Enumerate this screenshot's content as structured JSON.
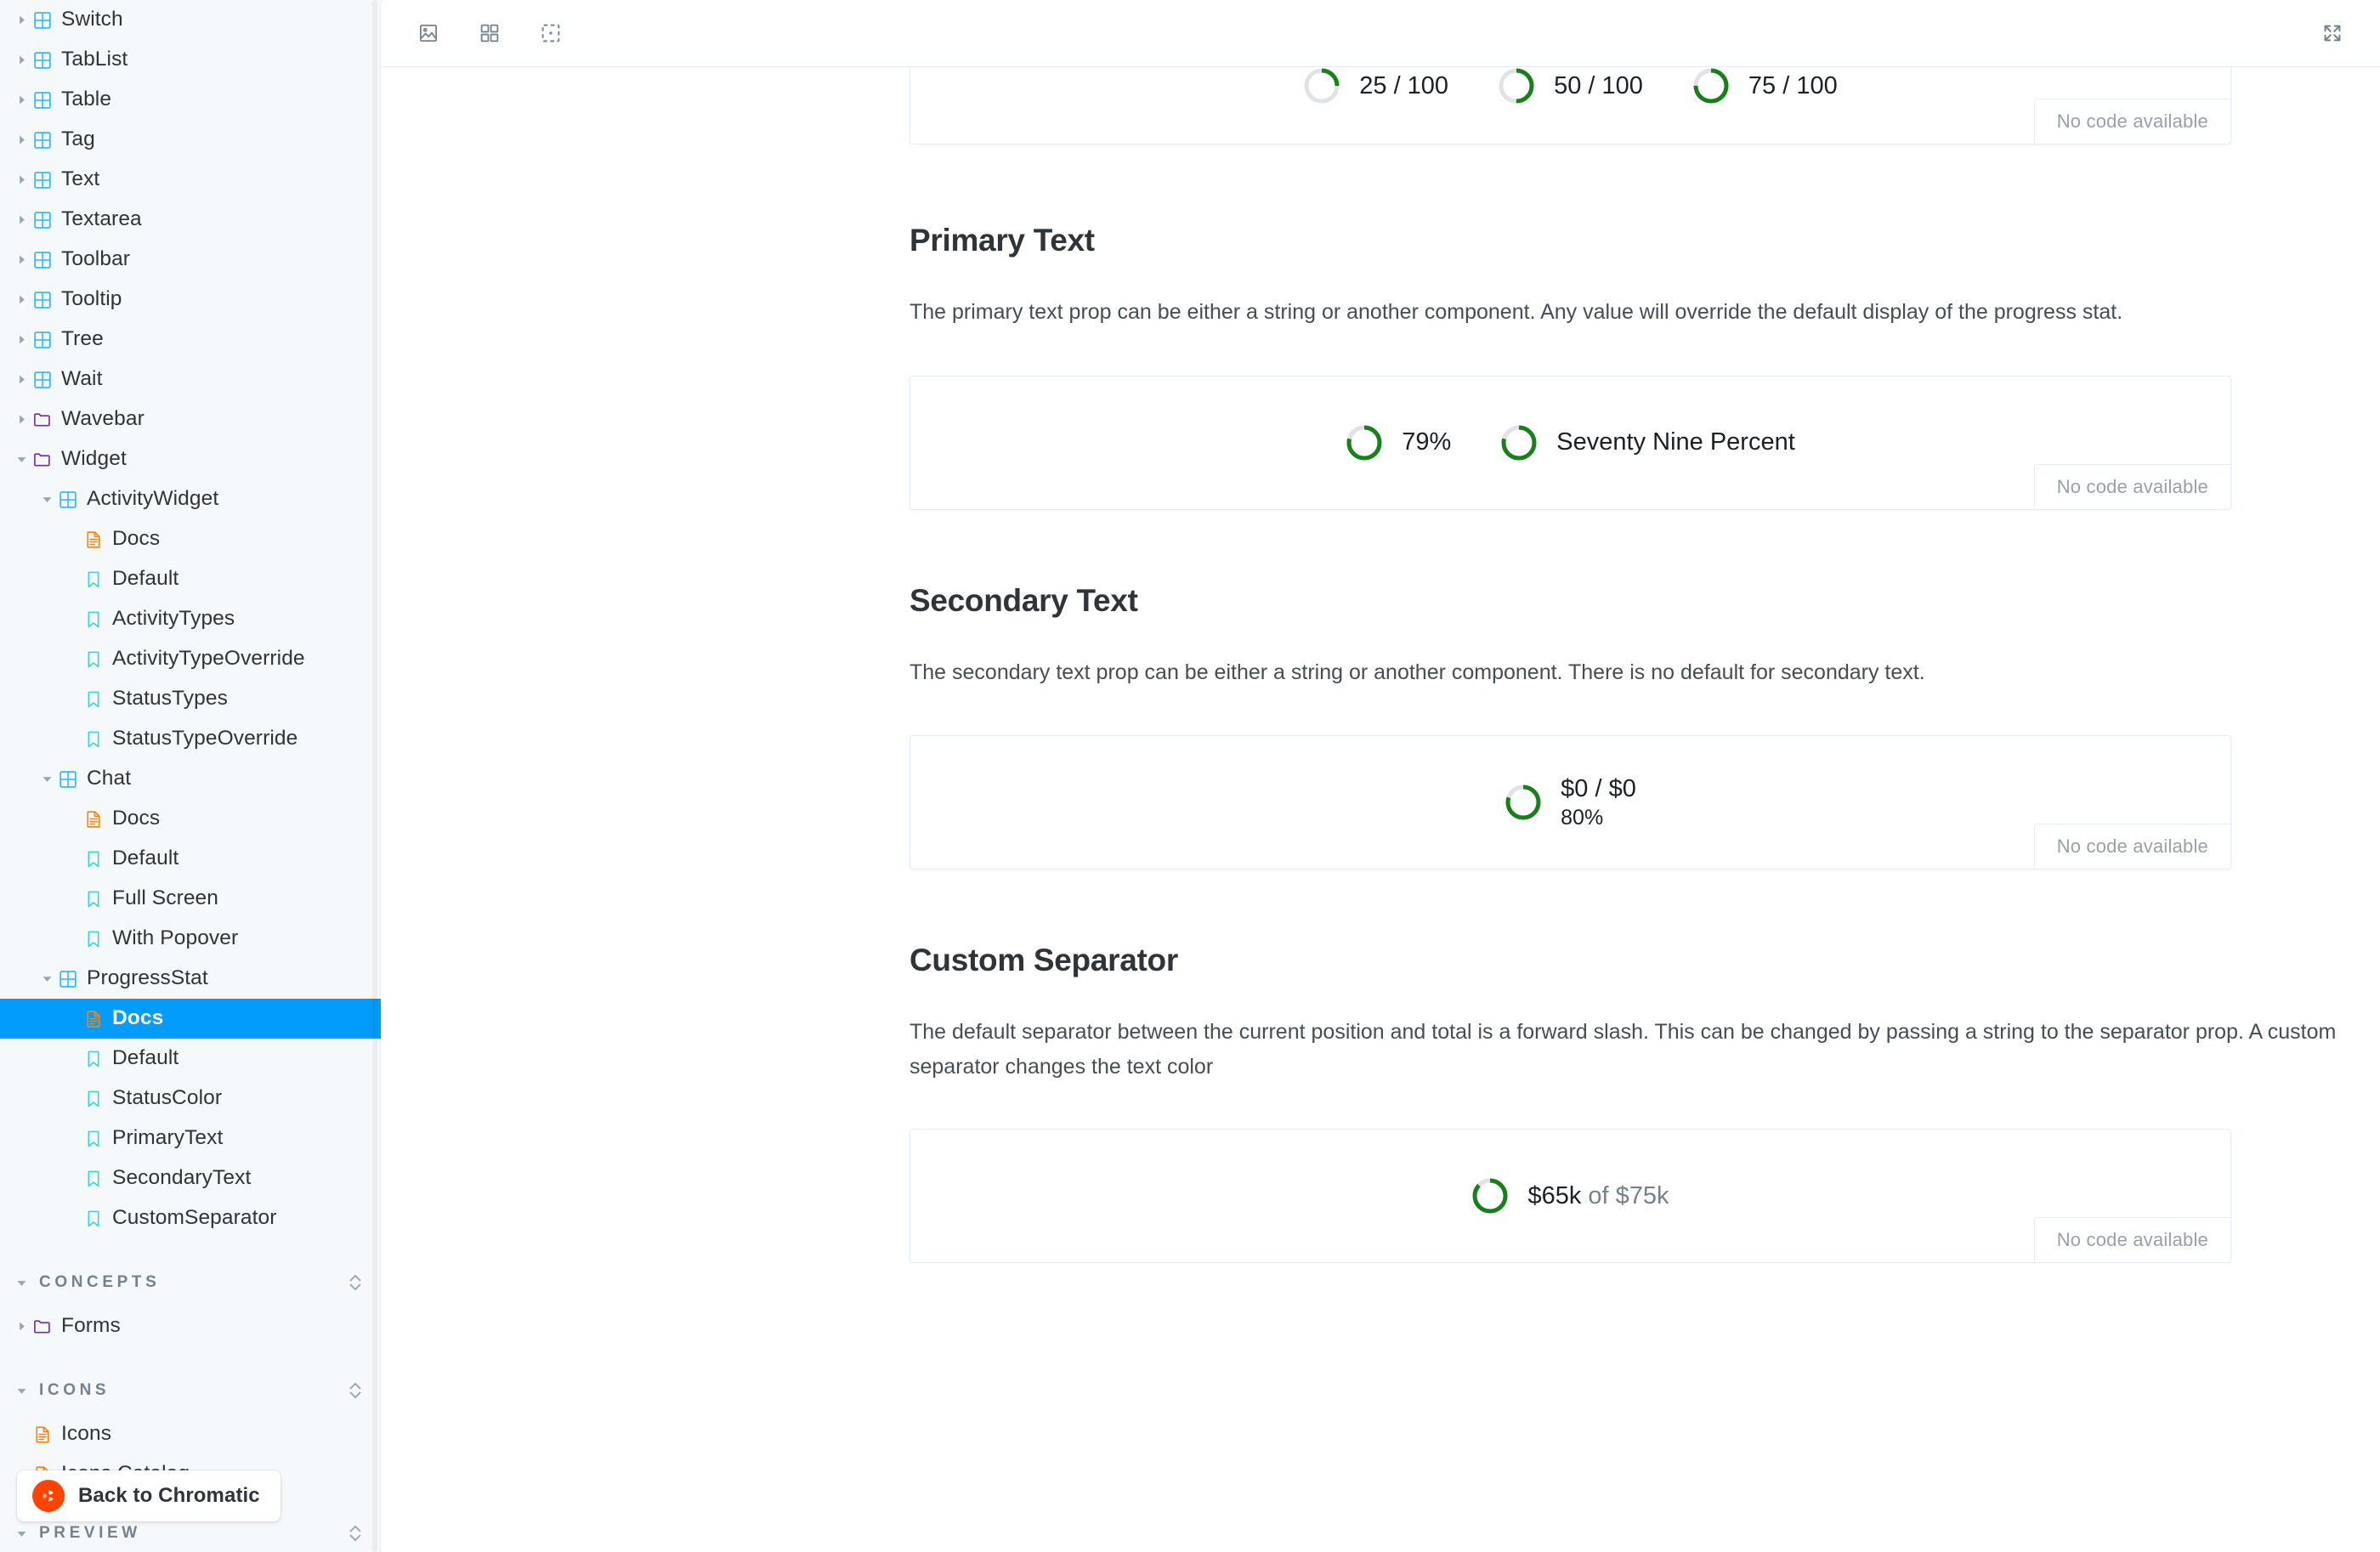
{
  "sidebar": {
    "tree": [
      {
        "label": "Switch",
        "depth": 0,
        "icon": "component-icon",
        "caret": "right",
        "selected": false
      },
      {
        "label": "TabList",
        "depth": 0,
        "icon": "component-icon",
        "caret": "right",
        "selected": false
      },
      {
        "label": "Table",
        "depth": 0,
        "icon": "component-icon",
        "caret": "right",
        "selected": false
      },
      {
        "label": "Tag",
        "depth": 0,
        "icon": "component-icon",
        "caret": "right",
        "selected": false
      },
      {
        "label": "Text",
        "depth": 0,
        "icon": "component-icon",
        "caret": "right",
        "selected": false
      },
      {
        "label": "Textarea",
        "depth": 0,
        "icon": "component-icon",
        "caret": "right",
        "selected": false
      },
      {
        "label": "Toolbar",
        "depth": 0,
        "icon": "component-icon",
        "caret": "right",
        "selected": false
      },
      {
        "label": "Tooltip",
        "depth": 0,
        "icon": "component-icon",
        "caret": "right",
        "selected": false
      },
      {
        "label": "Tree",
        "depth": 0,
        "icon": "component-icon",
        "caret": "right",
        "selected": false
      },
      {
        "label": "Wait",
        "depth": 0,
        "icon": "component-icon",
        "caret": "right",
        "selected": false
      },
      {
        "label": "Wavebar",
        "depth": 0,
        "icon": "folder-icon",
        "caret": "right",
        "selected": false
      },
      {
        "label": "Widget",
        "depth": 0,
        "icon": "folder-icon",
        "caret": "down",
        "selected": false
      },
      {
        "label": "ActivityWidget",
        "depth": 1,
        "icon": "component-icon",
        "caret": "down",
        "selected": false
      },
      {
        "label": "Docs",
        "depth": 2,
        "icon": "docs-icon",
        "caret": "none",
        "selected": false
      },
      {
        "label": "Default",
        "depth": 2,
        "icon": "story-icon",
        "caret": "none",
        "selected": false
      },
      {
        "label": "ActivityTypes",
        "depth": 2,
        "icon": "story-icon",
        "caret": "none",
        "selected": false
      },
      {
        "label": "ActivityTypeOverride",
        "depth": 2,
        "icon": "story-icon",
        "caret": "none",
        "selected": false
      },
      {
        "label": "StatusTypes",
        "depth": 2,
        "icon": "story-icon",
        "caret": "none",
        "selected": false
      },
      {
        "label": "StatusTypeOverride",
        "depth": 2,
        "icon": "story-icon",
        "caret": "none",
        "selected": false
      },
      {
        "label": "Chat",
        "depth": 1,
        "icon": "component-icon",
        "caret": "down",
        "selected": false
      },
      {
        "label": "Docs",
        "depth": 2,
        "icon": "docs-icon",
        "caret": "none",
        "selected": false
      },
      {
        "label": "Default",
        "depth": 2,
        "icon": "story-icon",
        "caret": "none",
        "selected": false
      },
      {
        "label": "Full Screen",
        "depth": 2,
        "icon": "story-icon",
        "caret": "none",
        "selected": false
      },
      {
        "label": "With Popover",
        "depth": 2,
        "icon": "story-icon",
        "caret": "none",
        "selected": false
      },
      {
        "label": "ProgressStat",
        "depth": 1,
        "icon": "component-icon",
        "caret": "down",
        "selected": false
      },
      {
        "label": "Docs",
        "depth": 2,
        "icon": "docs-icon",
        "caret": "none",
        "selected": true
      },
      {
        "label": "Default",
        "depth": 2,
        "icon": "story-icon",
        "caret": "none",
        "selected": false
      },
      {
        "label": "StatusColor",
        "depth": 2,
        "icon": "story-icon",
        "caret": "none",
        "selected": false
      },
      {
        "label": "PrimaryText",
        "depth": 2,
        "icon": "story-icon",
        "caret": "none",
        "selected": false
      },
      {
        "label": "SecondaryText",
        "depth": 2,
        "icon": "story-icon",
        "caret": "none",
        "selected": false
      },
      {
        "label": "CustomSeparator",
        "depth": 2,
        "icon": "story-icon",
        "caret": "none",
        "selected": false
      }
    ],
    "sections": [
      {
        "label": "CONCEPTS",
        "caret": "down"
      },
      {
        "label": "ICONS",
        "caret": "down"
      },
      {
        "label": "PREVIEW",
        "caret": "down"
      }
    ],
    "concepts_items": [
      {
        "label": "Forms",
        "depth": 0,
        "icon": "folder-icon",
        "caret": "right",
        "selected": false
      }
    ],
    "icons_items": [
      {
        "label": "Icons",
        "depth": 0,
        "icon": "docs-icon",
        "caret": "none",
        "selected": false
      },
      {
        "label": "Icons Catalog",
        "depth": 0,
        "icon": "docs-icon",
        "caret": "none",
        "selected": false
      }
    ],
    "chromatic_button": "Back to Chromatic"
  },
  "toolbar": {
    "buttons": [
      {
        "name": "image-snapshot-icon",
        "title": "Go full screen"
      },
      {
        "name": "grid-icon",
        "title": "Apply a grid"
      },
      {
        "name": "outline-icon",
        "title": "Apply outlines"
      }
    ],
    "expand_title": "Go full screen"
  },
  "main": {
    "no_code_label": "No code available",
    "status_card": {
      "stats": [
        {
          "primary": "25 / 100",
          "secondary": "",
          "percent": 25
        },
        {
          "primary": "50 / 100",
          "secondary": "",
          "percent": 50
        },
        {
          "primary": "75 / 100",
          "secondary": "",
          "percent": 75
        }
      ]
    },
    "sections": [
      {
        "id": "primary-text",
        "title": "Primary Text",
        "description": "The primary text prop can be either a string or another component. Any value will override the default display of the progress stat.",
        "stats": [
          {
            "primary": "79%",
            "secondary": "",
            "percent": 79
          },
          {
            "primary": "Seventy Nine Percent",
            "secondary": "",
            "percent": 79
          }
        ]
      },
      {
        "id": "secondary-text",
        "title": "Secondary Text",
        "description": "The secondary text prop can be either a string or another component. There is no default for secondary text.",
        "stats": [
          {
            "primary": "$0 / $0",
            "secondary": "80%",
            "percent": 80
          }
        ]
      },
      {
        "id": "custom-separator",
        "title": "Custom Separator",
        "description": "The default separator between the current position and total is a forward slash. This can be changed by passing a string to the separator prop. A custom separator changes the text color",
        "stats": [
          {
            "primary": "$65k",
            "primary_muted": " of $75k",
            "secondary": "",
            "percent": 87
          }
        ]
      }
    ]
  },
  "colors": {
    "accent": "#029cfd",
    "progress_green": "#17801b",
    "progress_track": "#e0e2e4",
    "story_icon": "#37d5d3",
    "docs_icon": "#ff8300",
    "folder_icon": "#6f2cac",
    "component_icon": "#29b5ff",
    "chromatic_red": "#ff4400"
  }
}
